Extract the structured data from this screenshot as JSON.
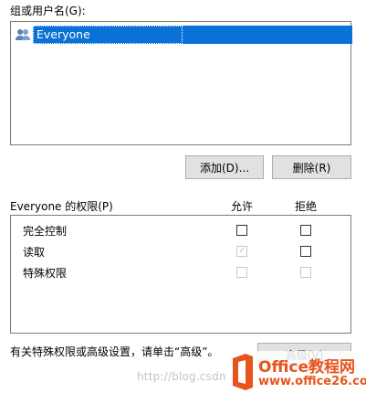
{
  "group_label": "组或用户名(G):",
  "users": [
    {
      "name": "Everyone",
      "icon": "users-icon",
      "selected": true
    }
  ],
  "buttons": {
    "add": "添加(D)...",
    "remove": "删除(R)",
    "advanced": "高级(V)"
  },
  "permissions": {
    "title": "Everyone 的权限(P)",
    "allow_header": "允许",
    "deny_header": "拒绝",
    "rows": [
      {
        "name": "完全控制",
        "allow": false,
        "deny": false,
        "allow_disabled": false,
        "deny_disabled": false
      },
      {
        "name": "读取",
        "allow": true,
        "deny": false,
        "allow_disabled": true,
        "deny_disabled": false
      },
      {
        "name": "特殊权限",
        "allow": false,
        "deny": false,
        "allow_disabled": true,
        "deny_disabled": true
      }
    ]
  },
  "advanced_hint": "有关特殊权限或高级设置，请单击“高级”。",
  "watermark": {
    "csdn": "http://blog.csdn.n",
    "brand": "Office教程网",
    "url": "www.office26.com"
  },
  "colors": {
    "selection": "#0a72d6",
    "button_bg": "#e1e1e1",
    "logo_orange": "#e8541e"
  }
}
